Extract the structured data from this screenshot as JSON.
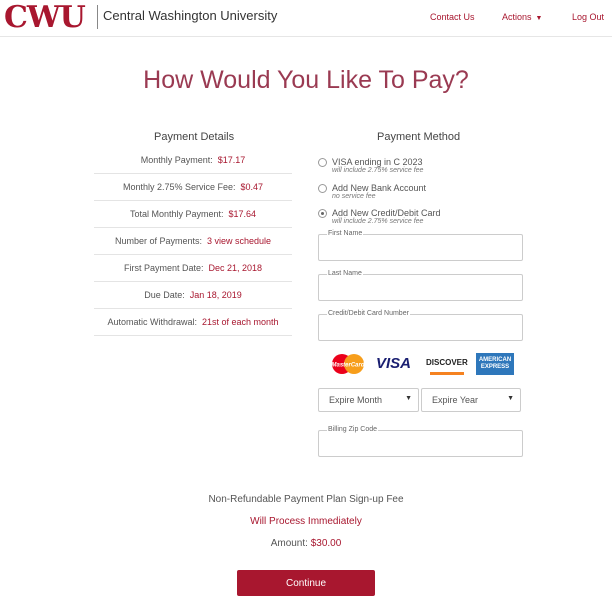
{
  "brand": {
    "logo": "CWU",
    "name": "Central Washington University",
    "accent": "#a8172f"
  },
  "nav": {
    "contact": "Contact Us",
    "actions": "Actions",
    "logout": "Log Out"
  },
  "title": "How Would You Like To Pay?",
  "payment_details": {
    "heading": "Payment Details",
    "rows": [
      {
        "label": "Monthly Payment:",
        "value": "$17.17"
      },
      {
        "label": "Monthly 2.75% Service Fee:",
        "value": "$0.47"
      },
      {
        "label": "Total Monthly Payment:",
        "value": "$17.64"
      },
      {
        "label": "Number of Payments:",
        "value": "3 view schedule"
      },
      {
        "label": "First Payment Date:",
        "value": "Dec 21, 2018"
      },
      {
        "label": "Due Date:",
        "value": "Jan 18, 2019"
      },
      {
        "label": "Automatic Withdrawal:",
        "value": "21st of each month"
      }
    ]
  },
  "payment_method": {
    "heading": "Payment Method",
    "options": [
      {
        "label": "VISA ending in C              2023",
        "sub": "will include 2.75% service fee",
        "selected": false
      },
      {
        "label": "Add New Bank Account",
        "sub": "no service fee",
        "selected": false
      },
      {
        "label": "Add New Credit/Debit Card",
        "sub": "will include 2.75% service fee",
        "selected": true
      }
    ],
    "fields": {
      "first_name": "First Name",
      "last_name": "Last Name",
      "card_number": "Credit/Debit Card Number",
      "zip": "Billing Zip Code"
    },
    "cards": {
      "mastercard": "MasterCard",
      "visa": "VISA",
      "discover": "DISCOVER",
      "amex_1": "AMERICAN",
      "amex_2": "EXPRESS"
    },
    "expire_month": "Expire Month",
    "expire_year": "Expire Year"
  },
  "fee": {
    "title": "Non-Refundable Payment Plan Sign-up Fee",
    "process": "Will Process Immediately",
    "amount_label": "Amount:",
    "amount_value": "$30.00"
  },
  "continue_label": "Continue"
}
